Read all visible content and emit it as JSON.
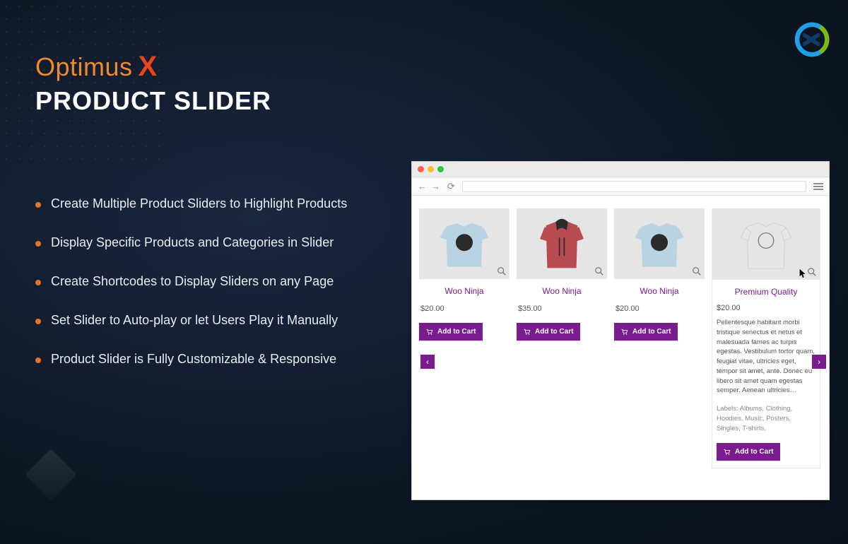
{
  "header": {
    "brand_line1_a": "Optimus",
    "brand_line1_b": "X",
    "subtitle": "PRODUCT SLIDER"
  },
  "features": [
    "Create Multiple Product Sliders to Highlight Products",
    "Display Specific Products and Categories in Slider",
    "Create Shortcodes to Display Sliders on any Page",
    "Set Slider to Auto-play or let Users Play it Manually",
    "Product Slider is Fully Customizable & Responsive"
  ],
  "slider": {
    "products": [
      {
        "title": "Woo Ninja",
        "price": "$20.00",
        "cta": "Add to Cart",
        "kind": "tshirt-blue"
      },
      {
        "title": "Woo Ninja",
        "price": "$35.00",
        "cta": "Add to Cart",
        "kind": "hoodie-red"
      },
      {
        "title": "Woo Ninja",
        "price": "$20.00",
        "cta": "Add to Cart",
        "kind": "tshirt-blue"
      }
    ],
    "premium": {
      "title": "Premium Quality",
      "price": "$20.00",
      "description": "Pellentesque habitant morbi tristique senectus et netus et malesuada fames ac turpis egestas. Vestibulum tortor quam, feugiat vitae, ultricies eget, tempor sit amet, ante. Donec eu libero sit amet quam egestas semper. Aenean ultricies…",
      "labels_prefix": "Labels: ",
      "labels": "Albums, Clothing, Hoodies, Music, Posters, Singles, T-shirts,",
      "cta": "Add to Cart",
      "kind": "tshirt-grey"
    },
    "prev_glyph": "‹",
    "next_glyph": "›"
  },
  "colors": {
    "accent_orange": "#e6732a",
    "accent_purple": "#7a1c8f"
  }
}
